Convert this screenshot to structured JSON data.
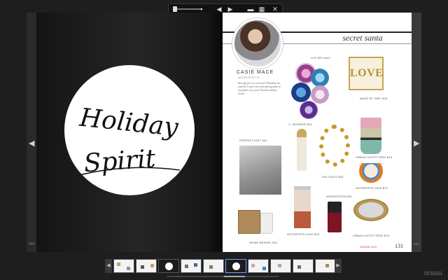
{
  "toolbar": {
    "prev_icon": "◀",
    "play_icon": "▶",
    "grid_icon": "▦",
    "close_icon": "✕"
  },
  "left_page": {
    "line1": "Holiday",
    "line2": "Spirit"
  },
  "right_page": {
    "section_title": "secret santa",
    "author_name": "CASIE MACE",
    "author_sub": "ANTHROPOSTYLE",
    "bio_text": "Best gift you ever received? Definitely my camera! I took a lot of fun photographs of my family every year. Favorite holiday treats?",
    "labels": {
      "top": "LOF $20 each",
      "love": "MADE BY GIRL $18",
      "agate": "C. WONDER $24",
      "scarf": "PERFECT KNIT $32",
      "brushes": "URBAN OUTFITTERS $18",
      "chain": "OIA JULES $32",
      "mug": "ANTHROPOLOGIE $12",
      "polish": "NORDSTROM $26",
      "tray": "URBAN OUTFITTERS $19",
      "tin": "ANTHROPOLOGIE $16",
      "candle": "HENRI BENDEL $30"
    },
    "footer": "HOLIDAY 2013",
    "page_number": "131"
  },
  "thumbnail_bar": {
    "left_arrow": "◀",
    "right_arrow": "▶"
  },
  "brand": "issuu"
}
